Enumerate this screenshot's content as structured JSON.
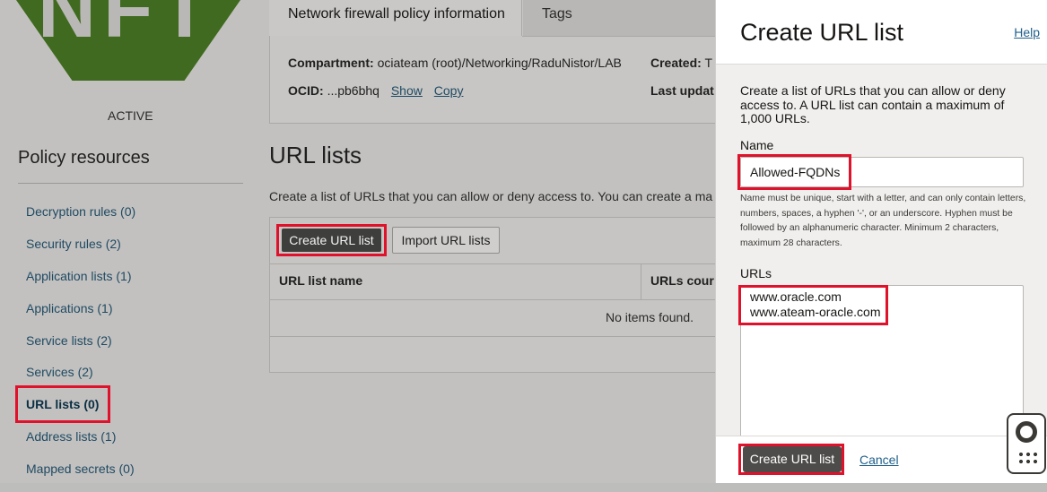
{
  "background": {
    "logo_text": "NFT",
    "status": "ACTIVE",
    "tabs": [
      "Network firewall policy information",
      "Tags"
    ],
    "info": {
      "compartment_label": "Compartment:",
      "compartment_value": "ociateam (root)/Networking/RaduNistor/LAB",
      "ocid_label": "OCID:",
      "ocid_value": "...pb6bhq",
      "show_link": "Show",
      "copy_link": "Copy",
      "created_label": "Created:",
      "created_value": "T",
      "last_updated_label": "Last updat"
    },
    "policy_resources": {
      "heading": "Policy resources",
      "items": [
        "Decryption rules (0)",
        "Security rules (2)",
        "Application lists (1)",
        "Applications (1)",
        "Service lists (2)",
        "Services (2)",
        "URL lists (0)",
        "Address lists (1)",
        "Mapped secrets (0)"
      ],
      "active_index": 6
    },
    "url_lists": {
      "heading": "URL lists",
      "description": "Create a list of URLs that you can allow or deny access to. You can create a ma",
      "create_button": "Create URL list",
      "import_button": "Import URL lists",
      "columns": [
        "URL list name",
        "URLs cour"
      ],
      "empty_message": "No items found."
    }
  },
  "panel": {
    "title": "Create URL list",
    "help": "Help",
    "description": "Create a list of URLs that you can allow or deny access to. A URL list can contain a maximum of 1,000 URLs.",
    "name_label": "Name",
    "name_value": "Allowed-FQDNs",
    "name_hint": "Name must be unique, start with a letter, and can only contain letters, numbers, spaces, a hyphen '-', or an underscore. Hyphen must be followed by an alphanumeric character. Minimum 2 characters, maximum 28 characters.",
    "urls_label": "URLs",
    "urls_value": "www.oracle.com\nwww.ateam-oracle.com",
    "submit_button": "Create URL list",
    "cancel_link": "Cancel"
  },
  "icons": {
    "help_widget": "lifebuoy-icon",
    "apps_grid": "grid-dots-icon"
  },
  "colors": {
    "highlight": "#e0112b",
    "logo_green": "#3f6a1f",
    "primary_button": "#4e4c4a",
    "link": "#1f5f8b"
  }
}
